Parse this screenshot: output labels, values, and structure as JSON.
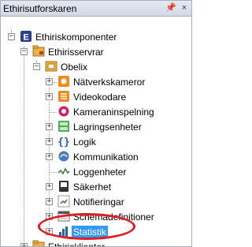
{
  "window": {
    "title": "Ethirisutforskaren",
    "pin_glyph": "ฟ",
    "close_glyph": "×"
  },
  "tree": {
    "root": {
      "label": "Ethiriskomponenter",
      "icon": "ethiris-e-icon"
    },
    "servers": {
      "label": "Ethirisservrar",
      "icon": "server-folder-icon"
    },
    "server": {
      "label": "Obelix",
      "icon": "server-icon"
    },
    "items": [
      {
        "label": "Nätverkskameror",
        "icon": "network-camera-icon"
      },
      {
        "label": "Videokodare",
        "icon": "video-encoder-icon"
      },
      {
        "label": "Kameraninspelning",
        "icon": "camera-recording-icon"
      },
      {
        "label": "Lagringsenheter",
        "icon": "storage-icon"
      },
      {
        "label": "Logik",
        "icon": "logic-braces-icon"
      },
      {
        "label": "Kommunikation",
        "icon": "communication-icon"
      },
      {
        "label": "Loggenheter",
        "icon": "log-icon"
      },
      {
        "label": "Säkerhet",
        "icon": "security-icon"
      },
      {
        "label": "Notifieringar",
        "icon": "notification-icon"
      },
      {
        "label": "Schemadefinitioner",
        "icon": "schedule-icon"
      },
      {
        "label": "Statistik",
        "icon": "statistics-icon",
        "selected": true
      }
    ],
    "clients": {
      "label": "Ethirisklienter",
      "icon": "client-folder-icon"
    }
  },
  "colors": {
    "selection": "#3399ff",
    "highlight": "#e01c24"
  }
}
